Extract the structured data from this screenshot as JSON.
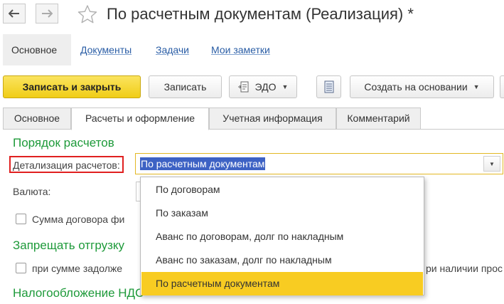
{
  "window": {
    "title": "По расчетным документам (Реализация) *"
  },
  "sections": [
    {
      "label": "Основное"
    },
    {
      "label": "Документы"
    },
    {
      "label": "Задачи"
    },
    {
      "label": "Мои заметки"
    }
  ],
  "toolbar": {
    "post_close": "Записать и закрыть",
    "save": "Записать",
    "edo": "ЭДО",
    "create_based": "Создать на основании"
  },
  "tabs": [
    {
      "label": "Основное"
    },
    {
      "label": "Расчеты и оформление"
    },
    {
      "label": "Учетная информация"
    },
    {
      "label": "Комментарий"
    }
  ],
  "form": {
    "settlement_order_heading": "Порядок расчетов",
    "detail_label": "Детализация расчетов:",
    "detail_value": "По расчетным документам",
    "currency_label": "Валюта:",
    "contract_sum_label": "Сумма договора фи",
    "forbid_shipment_heading": "Запрещать отгрузку",
    "debt_sum_label": "при сумме задолже",
    "debt_tail_label": "ри наличии прос",
    "vat_heading": "Налогообложение НДС"
  },
  "dropdown": {
    "options": [
      {
        "label": "По договорам"
      },
      {
        "label": "По заказам"
      },
      {
        "label": "Аванс по договорам, долг по накладным"
      },
      {
        "label": "Аванс по заказам, долг по накладным"
      },
      {
        "label": "По расчетным документам"
      }
    ],
    "selected_index": 4
  },
  "colors": {
    "accent_green": "#1e9a3a",
    "primary_button": "#f0cd16",
    "selected_option": "#f8cc22",
    "highlight_text_bg": "#3d62c4",
    "label_highlight_border": "#e02020"
  }
}
